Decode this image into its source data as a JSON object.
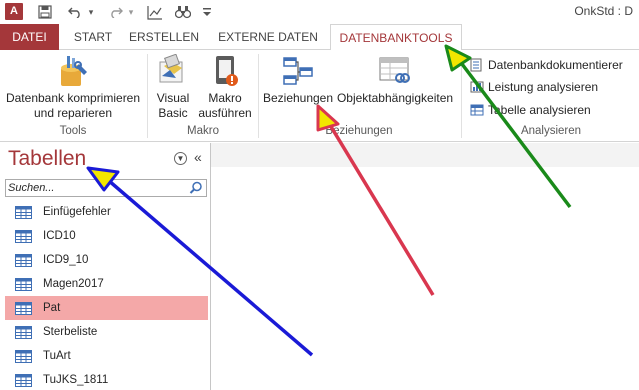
{
  "window": {
    "title": "OnkStd : D"
  },
  "tabs": [
    {
      "label": "DATEI"
    },
    {
      "label": "START"
    },
    {
      "label": "ERSTELLEN"
    },
    {
      "label": "EXTERNE DATEN"
    },
    {
      "label": "DATENBANKTOOLS"
    }
  ],
  "ribbon": {
    "tools": {
      "compact_line1": "Datenbank komprimieren",
      "compact_line2": "und reparieren",
      "group": "Tools"
    },
    "makro": {
      "vb_line1": "Visual",
      "vb_line2": "Basic",
      "run_line1": "Makro",
      "run_line2": "ausführen",
      "group": "Makro"
    },
    "beziehungen": {
      "relations": "Beziehungen",
      "dependencies": "Objektabhängigkeiten",
      "group": "Beziehungen"
    },
    "analysieren": {
      "documenter": "Datenbankdokumentierer",
      "performance": "Leistung analysieren",
      "table": "Tabelle analysieren",
      "group": "Analysieren"
    }
  },
  "nav": {
    "title": "Tabellen",
    "search_placeholder": "Suchen...",
    "items": [
      {
        "label": "Einfügefehler"
      },
      {
        "label": "ICD10"
      },
      {
        "label": "ICD9_10"
      },
      {
        "label": "Magen2017"
      },
      {
        "label": "Pat"
      },
      {
        "label": "Sterbeliste"
      },
      {
        "label": "TuArt"
      },
      {
        "label": "TuJKS_1811"
      }
    ]
  },
  "colors": {
    "accent": "#a4373a",
    "selected_row": "#f4a8a8",
    "arrow_blue": "#1a1ad6",
    "arrow_red": "#d9374f",
    "arrow_green": "#1a8a1a",
    "arrow_head": "#f2e600"
  }
}
